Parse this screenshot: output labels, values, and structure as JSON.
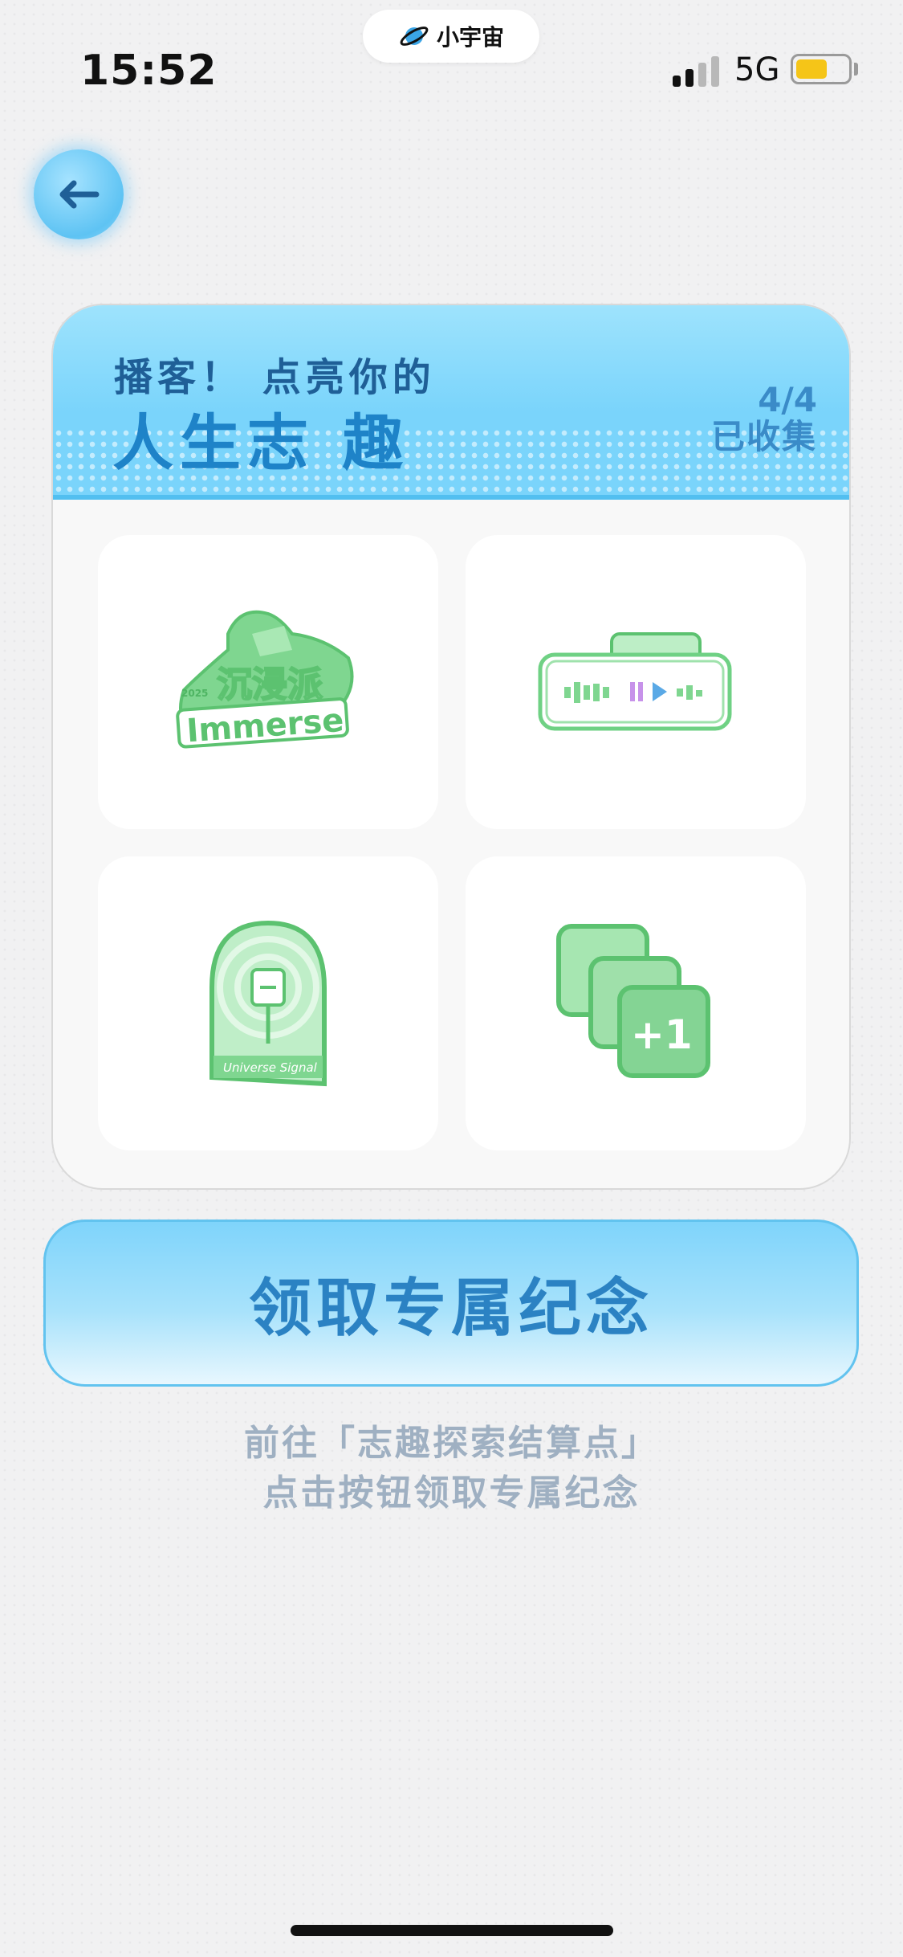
{
  "status_bar": {
    "time": "15:52",
    "island_label": "小宇宙",
    "network": "5G",
    "battery_color": "#f5c518"
  },
  "nav": {
    "back_icon": "arrow-left-icon"
  },
  "card": {
    "title_line1": "播客！ 点亮你的",
    "title_line2": "人生志 趣",
    "count": "4/4",
    "count_label": "已收集",
    "header_color": "#7ad4fb",
    "badges": [
      {
        "name": "immersive-badge",
        "year": "2025",
        "label_cn": "沉浸派",
        "label_en": "Immerse"
      },
      {
        "name": "audio-player-badge"
      },
      {
        "name": "signal-badge",
        "label_en": "Universe Signal"
      },
      {
        "name": "plus-one-badge",
        "label": "+1"
      }
    ]
  },
  "claim_button": {
    "label": "领取专属纪念",
    "color": "#2b82c3"
  },
  "hint": {
    "line1": "前往「志趣探索结算点」",
    "line2": "点击按钮领取专属纪念"
  }
}
